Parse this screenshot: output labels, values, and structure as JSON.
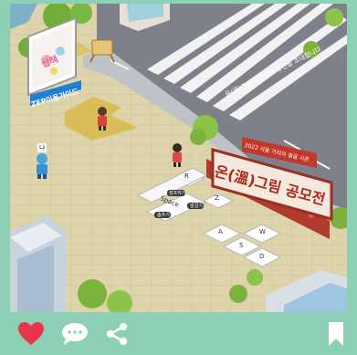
{
  "scene": {
    "billboard_label": "ZEP이용가이드",
    "board_text": "산책",
    "street_sign_text": "온(溫)그림 공모전에 당신을 초대합니다.",
    "banner_top": "2022 서울 가치의 얼굴 시즌",
    "banner_main": "온(溫)그림 공모전",
    "avatar_tag": "나",
    "keys": {
      "r": "R",
      "z": "Z",
      "jump_label": "점프하기",
      "talk_label": "말걸기",
      "space": "Space",
      "dance_label": "춤추기",
      "w": "W",
      "a": "A",
      "s": "S",
      "d": "D"
    }
  },
  "actions": {
    "like_icon": "heart-icon",
    "comment_icon": "speech-bubble-icon",
    "share_icon": "share-icon",
    "bookmark_icon": "bookmark-icon"
  },
  "colors": {
    "frame": "#8ed0b6",
    "heart": "#e8344a",
    "banner": "#c0392b"
  }
}
